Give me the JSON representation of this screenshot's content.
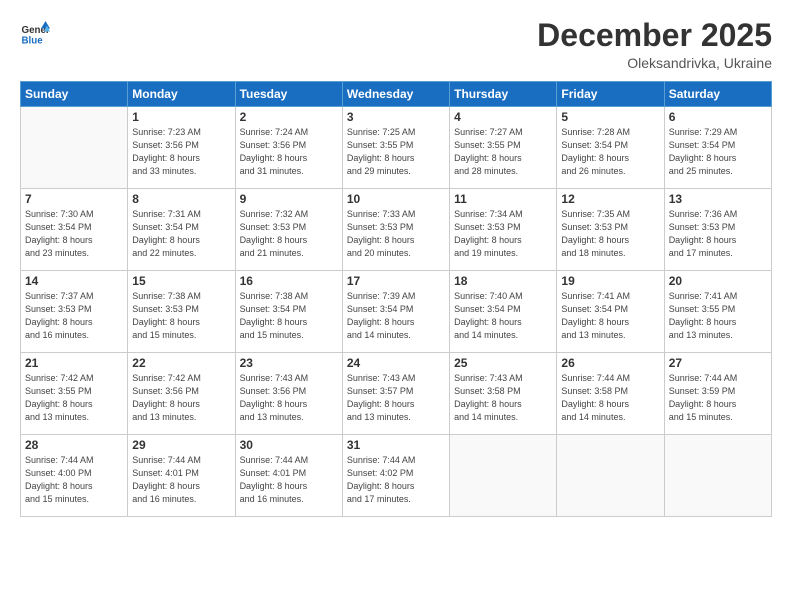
{
  "header": {
    "logo_general": "General",
    "logo_blue": "Blue",
    "month": "December 2025",
    "location": "Oleksandrivka, Ukraine"
  },
  "days_of_week": [
    "Sunday",
    "Monday",
    "Tuesday",
    "Wednesday",
    "Thursday",
    "Friday",
    "Saturday"
  ],
  "weeks": [
    [
      {
        "num": "",
        "info": ""
      },
      {
        "num": "1",
        "info": "Sunrise: 7:23 AM\nSunset: 3:56 PM\nDaylight: 8 hours\nand 33 minutes."
      },
      {
        "num": "2",
        "info": "Sunrise: 7:24 AM\nSunset: 3:56 PM\nDaylight: 8 hours\nand 31 minutes."
      },
      {
        "num": "3",
        "info": "Sunrise: 7:25 AM\nSunset: 3:55 PM\nDaylight: 8 hours\nand 29 minutes."
      },
      {
        "num": "4",
        "info": "Sunrise: 7:27 AM\nSunset: 3:55 PM\nDaylight: 8 hours\nand 28 minutes."
      },
      {
        "num": "5",
        "info": "Sunrise: 7:28 AM\nSunset: 3:54 PM\nDaylight: 8 hours\nand 26 minutes."
      },
      {
        "num": "6",
        "info": "Sunrise: 7:29 AM\nSunset: 3:54 PM\nDaylight: 8 hours\nand 25 minutes."
      }
    ],
    [
      {
        "num": "7",
        "info": "Sunrise: 7:30 AM\nSunset: 3:54 PM\nDaylight: 8 hours\nand 23 minutes."
      },
      {
        "num": "8",
        "info": "Sunrise: 7:31 AM\nSunset: 3:54 PM\nDaylight: 8 hours\nand 22 minutes."
      },
      {
        "num": "9",
        "info": "Sunrise: 7:32 AM\nSunset: 3:53 PM\nDaylight: 8 hours\nand 21 minutes."
      },
      {
        "num": "10",
        "info": "Sunrise: 7:33 AM\nSunset: 3:53 PM\nDaylight: 8 hours\nand 20 minutes."
      },
      {
        "num": "11",
        "info": "Sunrise: 7:34 AM\nSunset: 3:53 PM\nDaylight: 8 hours\nand 19 minutes."
      },
      {
        "num": "12",
        "info": "Sunrise: 7:35 AM\nSunset: 3:53 PM\nDaylight: 8 hours\nand 18 minutes."
      },
      {
        "num": "13",
        "info": "Sunrise: 7:36 AM\nSunset: 3:53 PM\nDaylight: 8 hours\nand 17 minutes."
      }
    ],
    [
      {
        "num": "14",
        "info": "Sunrise: 7:37 AM\nSunset: 3:53 PM\nDaylight: 8 hours\nand 16 minutes."
      },
      {
        "num": "15",
        "info": "Sunrise: 7:38 AM\nSunset: 3:53 PM\nDaylight: 8 hours\nand 15 minutes."
      },
      {
        "num": "16",
        "info": "Sunrise: 7:38 AM\nSunset: 3:54 PM\nDaylight: 8 hours\nand 15 minutes."
      },
      {
        "num": "17",
        "info": "Sunrise: 7:39 AM\nSunset: 3:54 PM\nDaylight: 8 hours\nand 14 minutes."
      },
      {
        "num": "18",
        "info": "Sunrise: 7:40 AM\nSunset: 3:54 PM\nDaylight: 8 hours\nand 14 minutes."
      },
      {
        "num": "19",
        "info": "Sunrise: 7:41 AM\nSunset: 3:54 PM\nDaylight: 8 hours\nand 13 minutes."
      },
      {
        "num": "20",
        "info": "Sunrise: 7:41 AM\nSunset: 3:55 PM\nDaylight: 8 hours\nand 13 minutes."
      }
    ],
    [
      {
        "num": "21",
        "info": "Sunrise: 7:42 AM\nSunset: 3:55 PM\nDaylight: 8 hours\nand 13 minutes."
      },
      {
        "num": "22",
        "info": "Sunrise: 7:42 AM\nSunset: 3:56 PM\nDaylight: 8 hours\nand 13 minutes."
      },
      {
        "num": "23",
        "info": "Sunrise: 7:43 AM\nSunset: 3:56 PM\nDaylight: 8 hours\nand 13 minutes."
      },
      {
        "num": "24",
        "info": "Sunrise: 7:43 AM\nSunset: 3:57 PM\nDaylight: 8 hours\nand 13 minutes."
      },
      {
        "num": "25",
        "info": "Sunrise: 7:43 AM\nSunset: 3:58 PM\nDaylight: 8 hours\nand 14 minutes."
      },
      {
        "num": "26",
        "info": "Sunrise: 7:44 AM\nSunset: 3:58 PM\nDaylight: 8 hours\nand 14 minutes."
      },
      {
        "num": "27",
        "info": "Sunrise: 7:44 AM\nSunset: 3:59 PM\nDaylight: 8 hours\nand 15 minutes."
      }
    ],
    [
      {
        "num": "28",
        "info": "Sunrise: 7:44 AM\nSunset: 4:00 PM\nDaylight: 8 hours\nand 15 minutes."
      },
      {
        "num": "29",
        "info": "Sunrise: 7:44 AM\nSunset: 4:01 PM\nDaylight: 8 hours\nand 16 minutes."
      },
      {
        "num": "30",
        "info": "Sunrise: 7:44 AM\nSunset: 4:01 PM\nDaylight: 8 hours\nand 16 minutes."
      },
      {
        "num": "31",
        "info": "Sunrise: 7:44 AM\nSunset: 4:02 PM\nDaylight: 8 hours\nand 17 minutes."
      },
      {
        "num": "",
        "info": ""
      },
      {
        "num": "",
        "info": ""
      },
      {
        "num": "",
        "info": ""
      }
    ]
  ]
}
